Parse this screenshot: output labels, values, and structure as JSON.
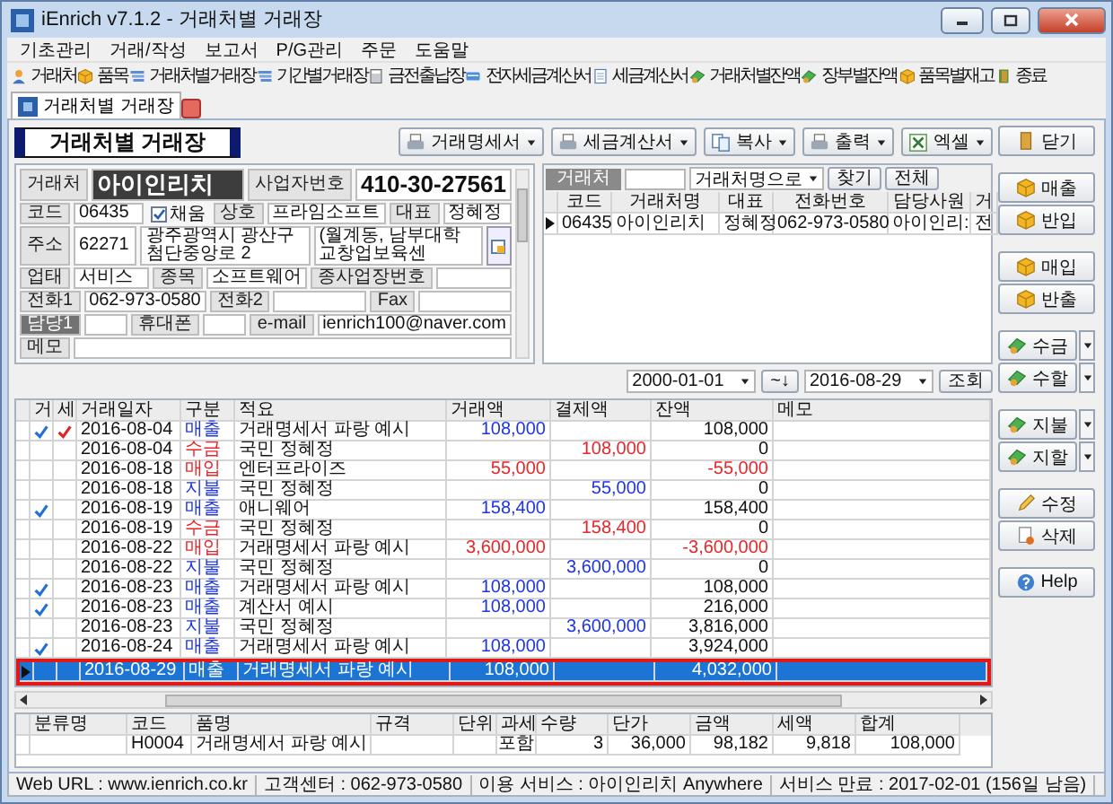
{
  "window": {
    "title": "iEnrich v7.1.2 - 거래처별 거래장"
  },
  "menu": [
    "기초관리",
    "거래/작성",
    "보고서",
    "P/G관리",
    "주문",
    "도움말"
  ],
  "toolbar": [
    "거래처",
    "품목",
    "거래처별거래장",
    "기간별거래장",
    "금전출납장",
    "전자세금계산서",
    "세금계산서",
    "거래처별잔액",
    "장부별잔액",
    "품목별재고",
    "종료"
  ],
  "tabs": [
    {
      "label": "거래처별 거래장",
      "selected": true
    }
  ],
  "page_title": "거래처별 거래장",
  "actions": [
    {
      "label": "거래명세서",
      "kind": "print"
    },
    {
      "label": "세금계산서",
      "kind": "print"
    },
    {
      "label": "복사",
      "kind": "copy"
    },
    {
      "label": "출력",
      "kind": "print"
    },
    {
      "label": "엑셀",
      "kind": "excel"
    }
  ],
  "form": {
    "rows": [
      [
        {
          "kind": "label",
          "text": "거래처"
        },
        {
          "kind": "name_value",
          "text": "아이인리치"
        },
        {
          "kind": "label",
          "text": "사업자번호"
        },
        {
          "kind": "big_value",
          "text": "410-30-27561"
        }
      ],
      [
        {
          "kind": "label",
          "text": "코드"
        },
        {
          "kind": "value",
          "text": "06435"
        },
        {
          "kind": "checkbox",
          "text": "채움",
          "checked": true
        },
        {
          "kind": "label",
          "text": "상호"
        },
        {
          "kind": "value",
          "text": "프라임소프트"
        },
        {
          "kind": "label",
          "text": "대표"
        },
        {
          "kind": "value",
          "text": "정혜정"
        }
      ],
      [
        {
          "kind": "label",
          "text": "주소"
        },
        {
          "kind": "value",
          "text": "62271"
        },
        {
          "kind": "long_value",
          "text": "광주광역시 광산구 첨단중앙로 2"
        },
        {
          "kind": "long_value",
          "text": "(월계동, 남부대학교창업보육센"
        },
        {
          "kind": "lookup"
        }
      ],
      [
        {
          "kind": "label",
          "text": "업태"
        },
        {
          "kind": "value",
          "text": "서비스"
        },
        {
          "kind": "label",
          "text": "종목"
        },
        {
          "kind": "value",
          "text": "소프트웨어"
        },
        {
          "kind": "label",
          "text": "종사업장번호"
        },
        {
          "kind": "value"
        }
      ],
      [
        {
          "kind": "label",
          "text": "전화1"
        },
        {
          "kind": "value",
          "text": "062-973-0580"
        },
        {
          "kind": "label",
          "text": "전화2"
        },
        {
          "kind": "value"
        },
        {
          "kind": "label",
          "text": "Fax"
        },
        {
          "kind": "value"
        }
      ],
      [
        {
          "kind": "active_label",
          "text": "담당1"
        },
        {
          "kind": "value"
        },
        {
          "kind": "label",
          "text": "휴대폰"
        },
        {
          "kind": "value"
        },
        {
          "kind": "label",
          "text": "e-mail"
        },
        {
          "kind": "value",
          "text": "ienrich100@naver.com"
        }
      ],
      [
        {
          "kind": "label",
          "text": "메모"
        },
        {
          "kind": "value"
        }
      ]
    ]
  },
  "search": {
    "label": "거래처",
    "mode": "거래처명으로",
    "buttons": [
      "찾기",
      "전체"
    ],
    "columns": [
      "코드",
      "거래처명",
      "대표",
      "전화번호",
      "담당사원",
      "거"
    ],
    "rows": [
      {
        "selected": true,
        "cells": [
          "06435",
          "아이인리치",
          "정혜정",
          "062-973-0580",
          "아이인리:",
          "전"
        ]
      }
    ]
  },
  "side_buttons": [
    [
      {
        "label": "닫기",
        "kind": "close",
        "dropdown": false
      }
    ],
    [
      {
        "label": "매출",
        "kind": "goods",
        "dropdown": false
      },
      {
        "label": "반입",
        "kind": "goods",
        "dropdown": false
      }
    ],
    [
      {
        "label": "매입",
        "kind": "goods",
        "dropdown": false
      },
      {
        "label": "반출",
        "kind": "goods",
        "dropdown": false
      }
    ],
    [
      {
        "label": "수금",
        "kind": "money",
        "dropdown": true
      },
      {
        "label": "수할",
        "kind": "money",
        "dropdown": true
      }
    ],
    [
      {
        "label": "지불",
        "kind": "money",
        "dropdown": true
      },
      {
        "label": "지할",
        "kind": "money",
        "dropdown": true
      }
    ],
    [
      {
        "label": "수정",
        "kind": "edit",
        "dropdown": false
      },
      {
        "label": "삭제",
        "kind": "delete",
        "dropdown": false
      }
    ],
    [
      {
        "label": "Help",
        "kind": "help",
        "dropdown": false
      }
    ]
  ],
  "date_filter": {
    "from": "2000-01-01",
    "range_button": "~↓",
    "to": "2016-08-29",
    "button": "조회"
  },
  "ledger": {
    "columns": [
      "거",
      "세",
      "거래일자",
      "구분",
      "적요",
      "거래액",
      "결제액",
      "잔액",
      "메모"
    ],
    "rows": [
      {
        "kind": "sale",
        "mark_1": true,
        "mark_2": true,
        "date": "2016-08-04",
        "type": "매출",
        "summary": "거래명세서 파랑 예시",
        "amount": "108,000",
        "balance": "108,000",
        "selected": false
      },
      {
        "kind": "receipt",
        "mark_1": false,
        "mark_2": false,
        "date": "2016-08-04",
        "type": "수금",
        "summary": "국민 정혜정",
        "paid": "108,000",
        "balance": "0",
        "selected": false
      },
      {
        "kind": "purchase",
        "mark_1": false,
        "mark_2": false,
        "date": "2016-08-18",
        "type": "매입",
        "summary": "엔터프라이즈",
        "amount": "55,000",
        "balance": "-55,000",
        "selected": false
      },
      {
        "kind": "payment",
        "mark_1": false,
        "mark_2": false,
        "date": "2016-08-18",
        "type": "지불",
        "summary": "국민 정혜정",
        "paid": "55,000",
        "balance": "0",
        "selected": false
      },
      {
        "kind": "sale",
        "mark_1": true,
        "mark_2": false,
        "date": "2016-08-19",
        "type": "매출",
        "summary": "애니웨어",
        "amount": "158,400",
        "balance": "158,400",
        "selected": false
      },
      {
        "kind": "receipt",
        "mark_1": false,
        "mark_2": false,
        "date": "2016-08-19",
        "type": "수금",
        "summary": "국민 정혜정",
        "paid": "158,400",
        "balance": "0",
        "selected": false
      },
      {
        "kind": "purchase",
        "mark_1": false,
        "mark_2": false,
        "date": "2016-08-22",
        "type": "매입",
        "summary": "거래명세서 파랑 예시",
        "amount": "3,600,000",
        "balance": "-3,600,000",
        "selected": false
      },
      {
        "kind": "payment",
        "mark_1": false,
        "mark_2": false,
        "date": "2016-08-22",
        "type": "지불",
        "summary": "국민 정혜정",
        "paid": "3,600,000",
        "balance": "0",
        "selected": false
      },
      {
        "kind": "sale",
        "mark_1": true,
        "mark_2": false,
        "date": "2016-08-23",
        "type": "매출",
        "summary": "거래명세서 파랑 예시",
        "amount": "108,000",
        "balance": "108,000",
        "selected": false
      },
      {
        "kind": "sale",
        "mark_1": true,
        "mark_2": false,
        "date": "2016-08-23",
        "type": "매출",
        "summary": "계산서 예시",
        "amount": "108,000",
        "balance": "216,000",
        "selected": false
      },
      {
        "kind": "payment",
        "mark_1": false,
        "mark_2": false,
        "date": "2016-08-23",
        "type": "지불",
        "summary": "국민 정혜정",
        "paid": "3,600,000",
        "balance": "3,816,000",
        "selected": false
      },
      {
        "kind": "sale",
        "mark_1": true,
        "mark_2": false,
        "date": "2016-08-24",
        "type": "매출",
        "summary": "거래명세서 파랑 예시",
        "amount": "108,000",
        "balance": "3,924,000",
        "selected": false
      },
      {
        "kind": "sale",
        "mark_1": false,
        "mark_2": false,
        "date": "2016-08-29",
        "type": "매출",
        "summary": "거래명세서 파랑 예시",
        "amount": "108,000",
        "balance": "4,032,000",
        "selected": true
      }
    ]
  },
  "items": {
    "columns": [
      "분류명",
      "코드",
      "품명",
      "규격",
      "단위",
      "과세",
      "수량",
      "단가",
      "금액",
      "세액",
      "합계"
    ],
    "rows": [
      {
        "code": "H0004",
        "name": "거래명세서 파랑 예시",
        "tax": "포함",
        "qty": "3",
        "price": "36,000",
        "supply": "98,182",
        "vat": "9,818",
        "total": "108,000"
      }
    ]
  },
  "status_bar": [
    "Web URL : www.ienrich.co.kr",
    "고객센터 : 062-973-0580",
    "이용 서비스 : 아이인리치 Anywhere",
    "서비스 만료 : 2017-02-01 (156일 남음)"
  ]
}
